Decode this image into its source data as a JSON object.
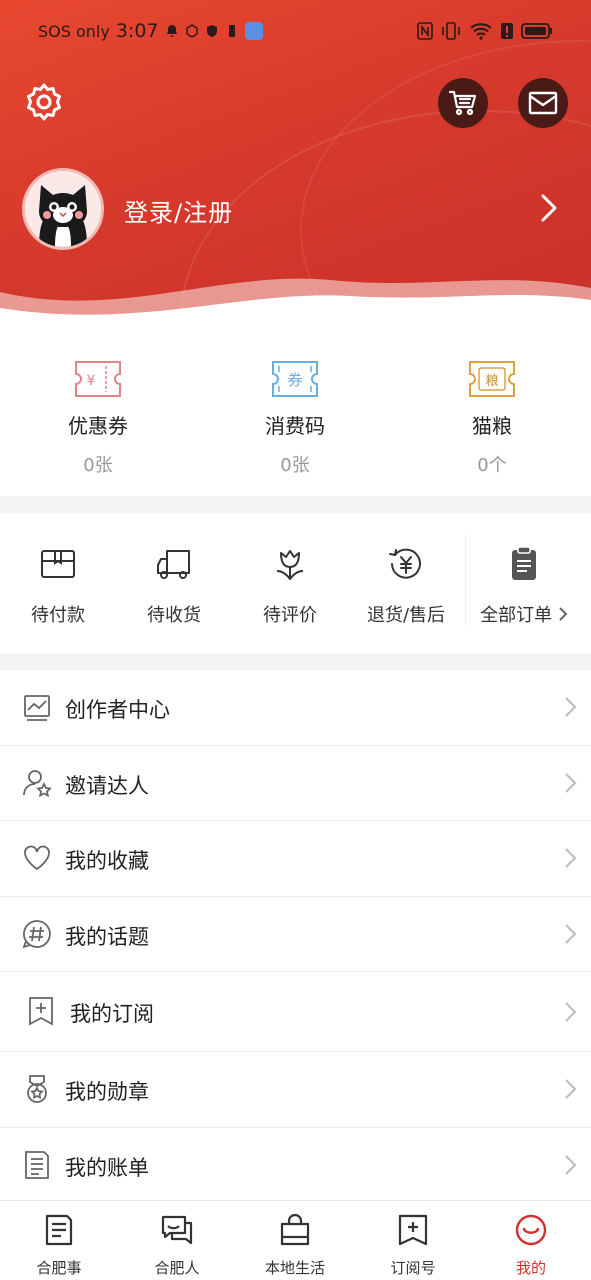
{
  "status_bar": {
    "carrier": "SOS only",
    "time": "3:07"
  },
  "header": {
    "login_label": "登录/注册"
  },
  "wallet": [
    {
      "label": "优惠券",
      "count": "0张",
      "icon": "coupon-icon",
      "glyph": "¥",
      "color": "#e0848a"
    },
    {
      "label": "消费码",
      "count": "0张",
      "icon": "voucher-code-icon",
      "glyph": "券",
      "color": "#6aaee0"
    },
    {
      "label": "猫粮",
      "count": "0个",
      "icon": "cat-food-icon",
      "glyph": "粮",
      "color": "#e0a040"
    }
  ],
  "orders": [
    {
      "label": "待付款",
      "icon": "wallet-icon"
    },
    {
      "label": "待收货",
      "icon": "truck-icon"
    },
    {
      "label": "待评价",
      "icon": "tulip-icon"
    },
    {
      "label": "退货/售后",
      "icon": "refund-icon"
    },
    {
      "label": "全部订单",
      "icon": "clipboard-icon"
    }
  ],
  "menu": [
    {
      "label": "创作者中心",
      "icon": "chart-icon"
    },
    {
      "label": "邀请达人",
      "icon": "invite-user-icon"
    },
    {
      "label": "我的收藏",
      "icon": "heart-icon"
    },
    {
      "label": "我的话题",
      "icon": "hashtag-icon"
    },
    {
      "label": "我的订阅",
      "icon": "bookmark-plus-icon"
    },
    {
      "label": "我的勋章",
      "icon": "medal-icon"
    },
    {
      "label": "我的账单",
      "icon": "bill-icon"
    }
  ],
  "nav": [
    {
      "label": "合肥事",
      "icon": "news-icon"
    },
    {
      "label": "合肥人",
      "icon": "chat-icon"
    },
    {
      "label": "本地生活",
      "icon": "shopping-bag-icon"
    },
    {
      "label": "订阅号",
      "icon": "subscribe-icon"
    },
    {
      "label": "我的",
      "icon": "smile-icon",
      "active": true
    }
  ],
  "colors": {
    "accent": "#d4302c",
    "header": "#d63a2c"
  }
}
